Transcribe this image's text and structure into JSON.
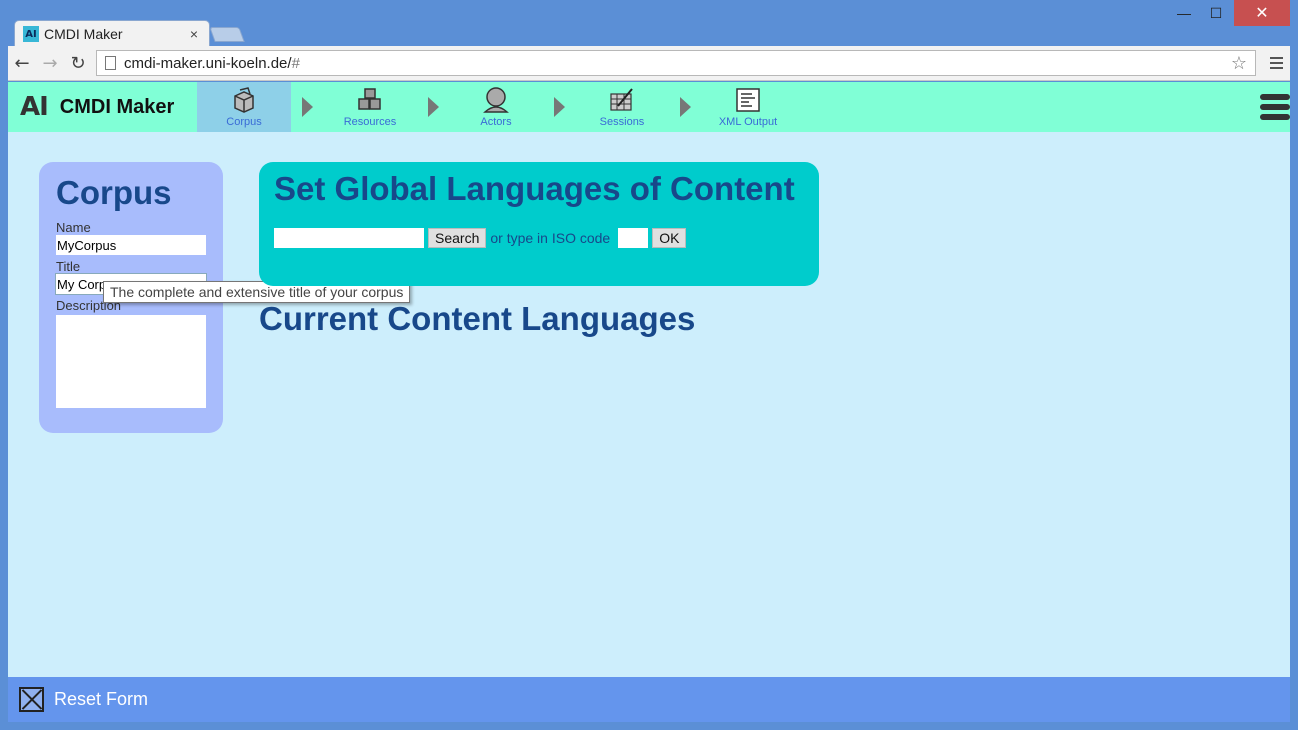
{
  "browser": {
    "tab_title": "CMDI Maker",
    "tab_favicon": "AI",
    "tab_close": "×",
    "url_main": "cmdi-maker.uni-koeln.de/",
    "url_hash": "#",
    "back": "←",
    "forward": "→",
    "reload": "↻",
    "star": "☆",
    "win_minimize": "—",
    "win_maximize": "☐",
    "win_close": "✕"
  },
  "app": {
    "logo": "AI",
    "name": "CMDI Maker",
    "workflow": [
      {
        "label": "Corpus",
        "icon": "corpus-box-icon",
        "active": true
      },
      {
        "label": "Resources",
        "icon": "resources-boxes-icon",
        "active": false
      },
      {
        "label": "Actors",
        "icon": "actor-person-icon",
        "active": false
      },
      {
        "label": "Sessions",
        "icon": "sessions-edit-icon",
        "active": false
      },
      {
        "label": "XML Output",
        "icon": "xml-document-icon",
        "active": false
      }
    ]
  },
  "corpus": {
    "title": "Corpus",
    "name_label": "Name",
    "name_value": "MyCorpus",
    "title_label": "Title",
    "title_value": "My Corpus",
    "description_label": "Description",
    "tooltip": "The complete and extensive title of your corpus"
  },
  "languages": {
    "title": "Set Global Languages of Content",
    "search_button": "Search",
    "or_text": "or type in ISO code",
    "ok_button": "OK",
    "current_title": "Current Content Languages"
  },
  "footer": {
    "reset_label": "Reset Form"
  }
}
